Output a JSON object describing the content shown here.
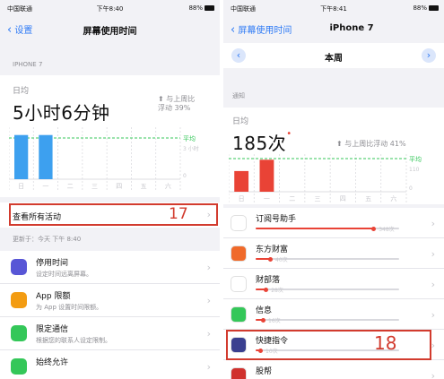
{
  "left": {
    "status": {
      "carrier": "中国联通",
      "time": "下午8:40",
      "right": "88%"
    },
    "nav": {
      "back": "设置",
      "title": "屏幕使用时间"
    },
    "device_label": "IPHONE 7",
    "daily_label": "日均",
    "daily_value": "5小时6分钟",
    "compare_line1": "与上周比",
    "compare_line2": "浮动 39%",
    "chart": {
      "avg_label": "平均",
      "y_labels": [
        "3 小时",
        "0"
      ],
      "days": [
        "日",
        "一",
        "二",
        "三",
        "四",
        "五",
        "六"
      ],
      "values": [
        0.85,
        0.85,
        0,
        0,
        0,
        0,
        0
      ],
      "bar_color": "#3da0ef"
    },
    "see_all": "查看所有活动",
    "anno17": "17",
    "updated": "更新于：今天 下午 8:40",
    "rows": [
      {
        "title": "停用时间",
        "sub": "设定时间远离屏幕。",
        "icon": "moon-icon",
        "color": "#5856d6"
      },
      {
        "title": "App 限额",
        "sub": "为 App 设置时间限额。",
        "icon": "hourglass-icon",
        "color": "#f39c12"
      },
      {
        "title": "限定通信",
        "sub": "根据您的联系人设定限制。",
        "icon": "person-icon",
        "color": "#34c759"
      },
      {
        "title": "始终允许",
        "sub": "",
        "icon": "check-icon",
        "color": "#34c759"
      }
    ]
  },
  "right": {
    "status": {
      "carrier": "中国联通",
      "time": "下午8:41",
      "right": "88%"
    },
    "nav": {
      "back": "屏幕使用时间",
      "title": "iPhone 7"
    },
    "week": "本周",
    "section": "通知",
    "daily_label": "日均",
    "daily_value": "185次",
    "compare": "与上周比浮动 41%",
    "chart": {
      "avg_label": "平均",
      "y_labels": [
        "110",
        "0"
      ],
      "days": [
        "日",
        "一",
        "二",
        "三",
        "四",
        "五",
        "六"
      ],
      "values": [
        0.55,
        0.85,
        0,
        0,
        0,
        0,
        0
      ],
      "bar_color": "#e94336"
    },
    "anno18": "18",
    "apps": [
      {
        "name": "订阅号助手",
        "count": "348次",
        "fill": 0.82,
        "icon": "subscription-icon",
        "color": "#ffffff"
      },
      {
        "name": "东方财富",
        "count": "40次",
        "fill": 0.1,
        "icon": "eastmoney-icon",
        "color": "#f06a2a"
      },
      {
        "name": "财部落",
        "count": "28次",
        "fill": 0.07,
        "icon": "caibuluo-icon",
        "color": "#ffffff"
      },
      {
        "name": "信息",
        "count": "16次",
        "fill": 0.05,
        "icon": "messages-icon",
        "color": "#34c759"
      },
      {
        "name": "快捷指令",
        "count": "10次",
        "fill": 0.03,
        "icon": "shortcuts-icon",
        "color": "#3a3f8f"
      },
      {
        "name": "股帮",
        "count": "",
        "fill": 0,
        "icon": "gubang-icon",
        "color": "#d0312d"
      }
    ]
  }
}
